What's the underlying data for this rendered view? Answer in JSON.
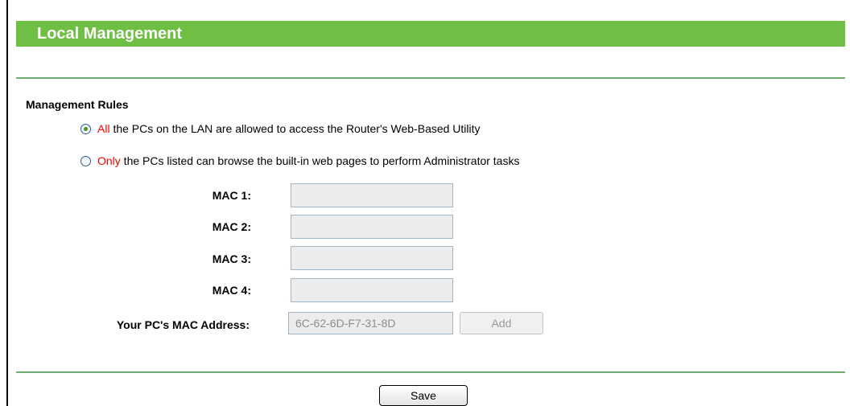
{
  "header": {
    "title": "Local Management"
  },
  "rules": {
    "section_title": "Management Rules",
    "options": [
      {
        "highlight": "All",
        "text": " the PCs on the LAN are allowed to access the Router's Web-Based Utility",
        "checked": true
      },
      {
        "highlight": "Only",
        "text": " the PCs listed can browse the built-in web pages to perform Administrator tasks",
        "checked": false
      }
    ]
  },
  "mac_fields": [
    {
      "label": "MAC 1:",
      "value": ""
    },
    {
      "label": "MAC 2:",
      "value": ""
    },
    {
      "label": "MAC 3:",
      "value": ""
    },
    {
      "label": "MAC 4:",
      "value": ""
    }
  ],
  "pc_mac": {
    "label": "Your PC's MAC Address:",
    "value": "6C-62-6D-F7-31-8D",
    "add_label": "Add"
  },
  "save_label": "Save",
  "colors": {
    "header_bg": "#6fbf44",
    "divider": "#6fae74",
    "highlight": "#ff0000"
  },
  "icons": {
    "radio_checked": "radio-checked-icon",
    "radio_unchecked": "radio-unchecked-icon"
  }
}
